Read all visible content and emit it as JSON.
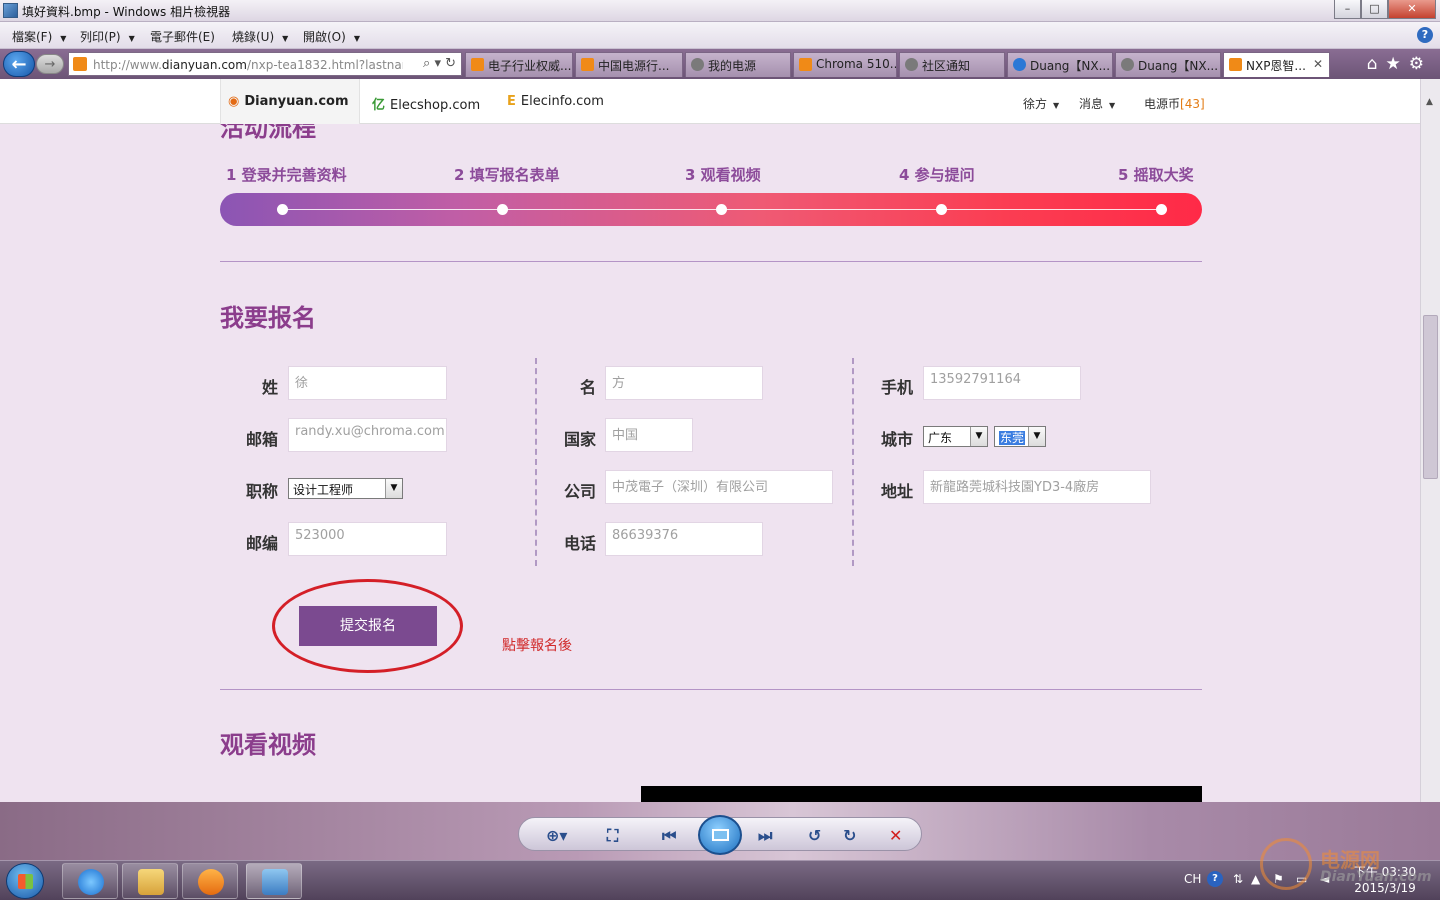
{
  "viewer": {
    "title": "填好資料.bmp - Windows 相片檢視器",
    "menu": [
      "檔案(F)",
      "列印(P)",
      "電子郵件(E)",
      "燒錄(U)",
      "開啟(O)"
    ],
    "help": "?",
    "window_buttons": {
      "minimize": "–",
      "maximize": "□",
      "close": "✕"
    }
  },
  "browser": {
    "url_prefix": "http://www.",
    "url_domain": "dianyuan.com",
    "url_suffix": "/nxp-tea1832.html?lastname",
    "back": "←",
    "forward": "→",
    "url_actions": "⌕ ▾ ↻",
    "tabs": [
      {
        "label": "电子行业权威...",
        "icon_color": "#f08a17"
      },
      {
        "label": "中国电源行...",
        "icon_color": "#f08a17"
      },
      {
        "label": "我的电源",
        "icon_color": "#7a7a7a"
      },
      {
        "label": "Chroma 510...",
        "icon_color": "#f08a17"
      },
      {
        "label": "社区通知",
        "icon_color": "#7a7a7a"
      },
      {
        "label": "Duang【NX...",
        "icon_color": "#2b78d6"
      },
      {
        "label": "Duang【NX...",
        "icon_color": "#7a7a7a"
      },
      {
        "label": "NXP恩智...",
        "icon_color": "#f08a17",
        "active": true
      }
    ],
    "tab_close": "✕",
    "tools": "⌂★⚙"
  },
  "site": {
    "sites": [
      {
        "logo": "◉",
        "name": "Dianyuan.com",
        "color": "#e36a14"
      },
      {
        "logo": "亿",
        "name": "Elecshop.com",
        "color": "#3a9a36"
      },
      {
        "logo": "E",
        "name": "Elecinfo.com",
        "color": "#e8a21b"
      }
    ],
    "user": "徐方",
    "messages": "消息",
    "coins_label": "电源币",
    "coins_value": "[43]"
  },
  "page": {
    "cut_heading": "活动流程",
    "steps": [
      "1 登录并完善资料",
      "2 填写报名表单",
      "3 观看视频",
      "4 参与提问",
      "5 摇取大奖"
    ],
    "register_title": "我要报名",
    "watch_title": "观看视频",
    "submit_label": "提交报名",
    "note": "點擊報名後",
    "form": {
      "last_name_label": "姓",
      "last_name": "徐",
      "first_name_label": "名",
      "first_name": "方",
      "mobile_label": "手机",
      "mobile": "13592791164",
      "email_label": "邮箱",
      "email": "randy.xu@chroma.com",
      "country_label": "国家",
      "country": "中国",
      "city_label": "城市",
      "province": "广东",
      "city": "东莞",
      "title_label": "职称",
      "title": "设计工程师",
      "company_label": "公司",
      "company": "中茂電子（深圳）有限公司",
      "address_label": "地址",
      "address": "新龍路莞城科技園YD3-4廠房",
      "zip_label": "邮编",
      "zip": "523000",
      "phone_label": "电话",
      "phone": "86639376"
    }
  },
  "taskbar": {
    "lang": "CH",
    "help": "?",
    "time": "下午 03:30",
    "date": "2015/3/19"
  },
  "watermark": {
    "cn": "电源网",
    "en": "DianYuan.com"
  },
  "colors": {
    "accent_purple": "#8b3d8c",
    "button_purple": "#7b4a90",
    "annotation_red": "#d41f27",
    "coin_orange": "#e37b13"
  }
}
